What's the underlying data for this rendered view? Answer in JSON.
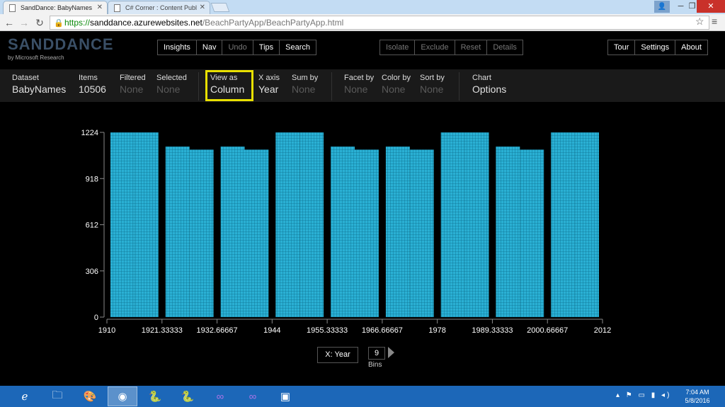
{
  "browser": {
    "tabs": [
      {
        "title": "SandDance: BabyNames",
        "active": true
      },
      {
        "title": "C# Corner : Content Publ",
        "active": false
      }
    ],
    "url": {
      "scheme": "https://",
      "host": "sanddance.azurewebsites.net",
      "path": "/BeachPartyApp/BeachPartyApp.html"
    }
  },
  "app": {
    "logo": "SANDDANCE",
    "logo_sub": "by Microsoft Research",
    "nav_group": [
      "Insights",
      "Nav",
      "Undo",
      "Tips",
      "Search"
    ],
    "selection_group": [
      "Isolate",
      "Exclude",
      "Reset",
      "Details"
    ],
    "right_group": [
      "Tour",
      "Settings",
      "About"
    ]
  },
  "infobar": {
    "dataset": {
      "label": "Dataset",
      "value": "BabyNames"
    },
    "items": {
      "label": "Items",
      "value": "10506"
    },
    "filtered": {
      "label": "Filtered",
      "value": "None"
    },
    "selected": {
      "label": "Selected",
      "value": "None"
    },
    "view_as": {
      "label": "View as",
      "value": "Column"
    },
    "x_axis": {
      "label": "X axis",
      "value": "Year"
    },
    "sum_by": {
      "label": "Sum by",
      "value": "None"
    },
    "facet_by": {
      "label": "Facet by",
      "value": "None"
    },
    "color_by": {
      "label": "Color by",
      "value": "None"
    },
    "sort_by": {
      "label": "Sort by",
      "value": "None"
    },
    "chart": {
      "label": "Chart",
      "value": "Options"
    }
  },
  "chart_data": {
    "type": "bar",
    "bar_color": "#2ab0d4",
    "x_ticks": [
      "1910",
      "1921.33333",
      "1932.66667",
      "1944",
      "1955.33333",
      "1966.66667",
      "1978",
      "1989.33333",
      "2000.66667",
      "2012"
    ],
    "y_ticks": [
      "0",
      "306",
      "612",
      "918",
      "1224"
    ],
    "ylim": [
      0,
      1224
    ],
    "values": [
      1224,
      1224,
      1130,
      1110,
      1130,
      1110,
      1224,
      1224,
      1130,
      1110,
      1130,
      1110,
      1224,
      1224,
      1130,
      1110,
      1224,
      1224
    ]
  },
  "controls": {
    "x_button": "X: Year",
    "bins_value": "9",
    "bins_label": "Bins"
  },
  "taskbar": {
    "time": "7:04 AM",
    "date": "5/8/2016"
  }
}
